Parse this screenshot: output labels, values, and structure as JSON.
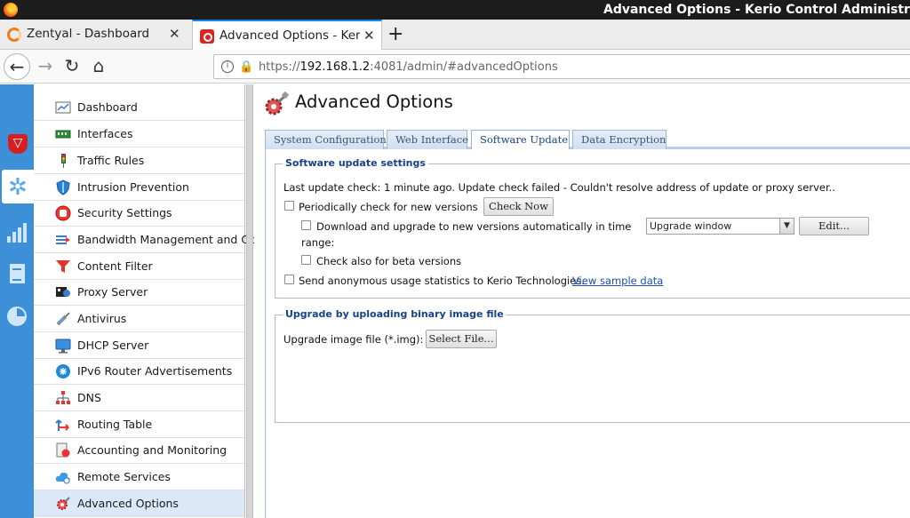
{
  "window": {
    "title": "Advanced Options - Kerio Control Administration"
  },
  "browser": {
    "tabs": [
      {
        "label": "Zentyal - Dashboard",
        "icon": "zentyal-icon"
      },
      {
        "label": "Advanced Options - Kerio Control",
        "icon": "kerio-icon",
        "active": true
      }
    ],
    "url_prefix": "https://",
    "url_host": "192.168.1.2",
    "url_rest": ":4081/admin/#advancedOptions"
  },
  "sidebar": {
    "rail": [
      "shield-icon",
      "settings-gear-icon",
      "statistics-bars-icon",
      "logs-document-icon",
      "status-pie-icon"
    ],
    "items": [
      {
        "label": "Dashboard",
        "icon": "dashboard-icon"
      },
      {
        "label": "Interfaces",
        "icon": "interfaces-icon"
      },
      {
        "label": "Traffic Rules",
        "icon": "traffic-light-icon"
      },
      {
        "label": "Intrusion Prevention",
        "icon": "shield-icon"
      },
      {
        "label": "Security Settings",
        "icon": "hand-stop-icon"
      },
      {
        "label": "Bandwidth Management and QoS",
        "icon": "bandwidth-icon"
      },
      {
        "label": "Content Filter",
        "icon": "funnel-icon"
      },
      {
        "label": "Proxy Server",
        "icon": "proxy-icon"
      },
      {
        "label": "Antivirus",
        "icon": "syringe-icon"
      },
      {
        "label": "DHCP Server",
        "icon": "monitor-icon"
      },
      {
        "label": "IPv6 Router Advertisements",
        "icon": "ipv6-icon"
      },
      {
        "label": "DNS",
        "icon": "dns-tree-icon"
      },
      {
        "label": "Routing Table",
        "icon": "routing-arrows-icon"
      },
      {
        "label": "Accounting and Monitoring",
        "icon": "accounting-icon"
      },
      {
        "label": "Remote Services",
        "icon": "cloud-icon"
      },
      {
        "label": "Advanced Options",
        "icon": "gears-icon",
        "selected": true
      }
    ]
  },
  "main": {
    "title": "Advanced Options",
    "tabs": [
      {
        "label": "System Configuration"
      },
      {
        "label": "Web Interface"
      },
      {
        "label": "Software Update",
        "active": true
      },
      {
        "label": "Data Encryption"
      }
    ],
    "update": {
      "legend": "Software update settings",
      "status": "Last update check: 1 minute ago. Update check failed - Couldn't resolve address of update or proxy server..",
      "periodic_label": "Periodically check for new versions",
      "check_now": "Check Now",
      "auto_label_line1": "Download and upgrade to new versions automatically in time",
      "auto_label_line2": "range:",
      "window_value": "Upgrade window",
      "edit": "Edit...",
      "beta_label": "Check also for beta versions",
      "anon_label": "Send anonymous usage statistics to Kerio Technologies.",
      "sample_link": "View sample data"
    },
    "upload": {
      "legend": "Upgrade by uploading binary image file",
      "file_label": "Upgrade image file (*.img):",
      "select_file": "Select File..."
    }
  },
  "colors": {
    "accent": "#3d8fd8",
    "link": "#1a4fb4",
    "legend": "#15428b"
  }
}
